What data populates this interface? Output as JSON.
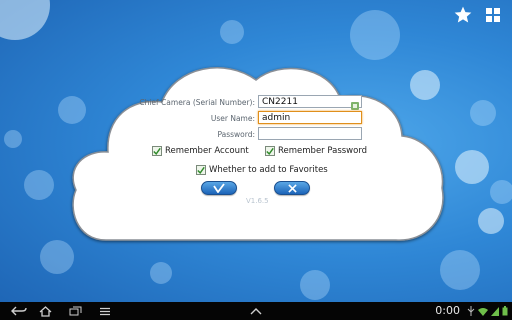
{
  "form": {
    "camera_label": "Chief Camera (Serial Number):",
    "camera_value": "CN2211",
    "username_label": "User Name:",
    "username_value": "admin",
    "password_label": "Password:",
    "password_value": "",
    "remember_account_label": "Remember Account",
    "remember_account_checked": true,
    "remember_password_label": "Remember Password",
    "remember_password_checked": true,
    "favorites_label": "Whether to add to Favorites",
    "favorites_checked": true,
    "confirm_icon": "check-icon",
    "cancel_icon": "close-icon",
    "version": "V1.6.5"
  },
  "top_icons": [
    "star-icon",
    "grid-icon"
  ],
  "statusbar": {
    "clock": "0:00",
    "icons": [
      "usb-icon",
      "wifi-icon",
      "signal-icon",
      "battery-icon"
    ]
  },
  "navbar": {
    "icons": [
      "back-icon",
      "home-icon",
      "recent-apps-icon",
      "menu-icon",
      "up-arrow-icon"
    ]
  }
}
